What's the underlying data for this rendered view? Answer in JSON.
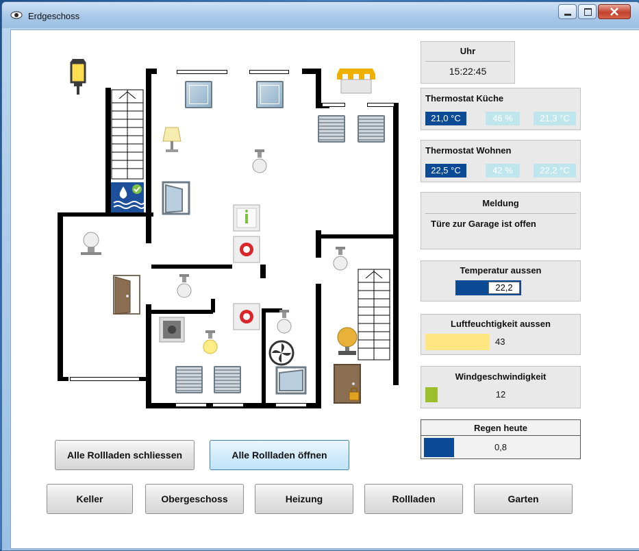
{
  "window": {
    "title": "Erdgeschoss"
  },
  "clock": {
    "label": "Uhr",
    "time": "15:22:45"
  },
  "thermostat_kueche": {
    "label": "Thermostat Küche",
    "temp": "21,0 °C",
    "humidity": "46 %",
    "setpoint": "21,3 °C"
  },
  "thermostat_wohnen": {
    "label": "Thermostat Wohnen",
    "temp": "22,5 °C",
    "humidity": "42 %",
    "setpoint": "22,2 °C"
  },
  "message": {
    "label": "Meldung",
    "text": "Türe zur Garage ist offen"
  },
  "temp_outside": {
    "label": "Temperatur aussen",
    "value": "22,2"
  },
  "humidity_outside": {
    "label": "Luftfeuchtigkeit aussen",
    "value": "43"
  },
  "wind": {
    "label": "Windgeschwindigkeit",
    "value": "12"
  },
  "rain": {
    "label": "Regen heute",
    "value": "0,8"
  },
  "shutter_buttons": {
    "close_all": "Alle Rollladen schliessen",
    "open_all": "Alle Rollladen öffnen"
  },
  "nav": {
    "keller": "Keller",
    "obergeschoss": "Obergeschoss",
    "heizung": "Heizung",
    "rollladen": "Rollladen",
    "garten": "Garten"
  },
  "colors": {
    "accent_dark": "#0b4a94",
    "accent_light": "#bfe6ec",
    "humidity_bar": "#ffe680",
    "wind_bar": "#9cbf2a",
    "rain_bar": "#0b4a94"
  }
}
